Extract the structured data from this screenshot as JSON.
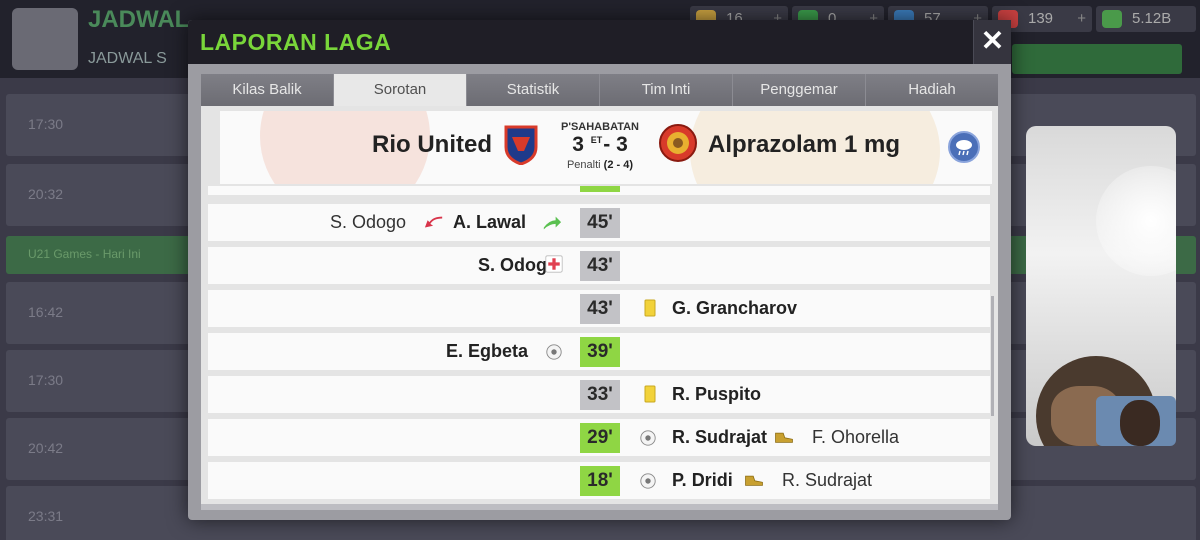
{
  "background": {
    "screen_title": "JADWAL",
    "screen_subtitle": "JADWAL S",
    "resources": [
      {
        "value": "16",
        "color": "#c8a040"
      },
      {
        "value": "0",
        "color": "#3a9a4a"
      },
      {
        "value": "57",
        "color": "#3a7ab8"
      },
      {
        "value": "139",
        "color": "#c84040"
      },
      {
        "value": "5.12B",
        "color": "#4a9a4a"
      }
    ],
    "plus_label": "+",
    "rows": [
      "17:30",
      "20:32",
      "U21 Games - Hari Ini",
      "16:42",
      "17:30",
      "20:42",
      "23:31"
    ]
  },
  "modal": {
    "title": "LAPORAN LAGA",
    "close_label": "✕",
    "tabs": [
      "Kilas Balik",
      "Sorotan",
      "Statistik",
      "Tim Inti",
      "Penggemar",
      "Hadiah"
    ],
    "active_tab": "Sorotan"
  },
  "match": {
    "competition": "P'SAHABATAN",
    "home_team": "Rio United",
    "away_team": "Alprazolam 1 mg",
    "home_score": "3",
    "away_score": "3",
    "et_label": "ET",
    "score_sep": "-",
    "penalty_label": "Penalti",
    "penalty_score": "(2 - 4)",
    "home_color": "#1f3a8a",
    "away_color": "#d83a2a",
    "weather_icon": "rain-icon"
  },
  "events": [
    {
      "minute": "45'",
      "type": "substitution",
      "side": "home",
      "player": "A. Lawal",
      "secondary": "S. Odogo",
      "goal": false
    },
    {
      "minute": "43'",
      "type": "injury",
      "side": "home",
      "player": "S. Odogo",
      "secondary": "",
      "goal": false
    },
    {
      "minute": "43'",
      "type": "yellow-card",
      "side": "away",
      "player": "G. Grancharov",
      "secondary": "",
      "goal": false
    },
    {
      "minute": "39'",
      "type": "goal",
      "side": "home",
      "player": "E. Egbeta",
      "secondary": "",
      "goal": true
    },
    {
      "minute": "33'",
      "type": "yellow-card",
      "side": "away",
      "player": "R. Puspito",
      "secondary": "",
      "goal": false
    },
    {
      "minute": "29'",
      "type": "goal",
      "side": "away",
      "player": "R. Sudrajat",
      "secondary": "F. Ohorella",
      "goal": true
    },
    {
      "minute": "18'",
      "type": "goal",
      "side": "away",
      "player": "P. Dridi",
      "secondary": "R. Sudrajat",
      "goal": true
    }
  ],
  "colors": {
    "accent_green": "#79d63a",
    "goal_minute": "#8fd644",
    "yellow_card": "#f2d23a"
  }
}
